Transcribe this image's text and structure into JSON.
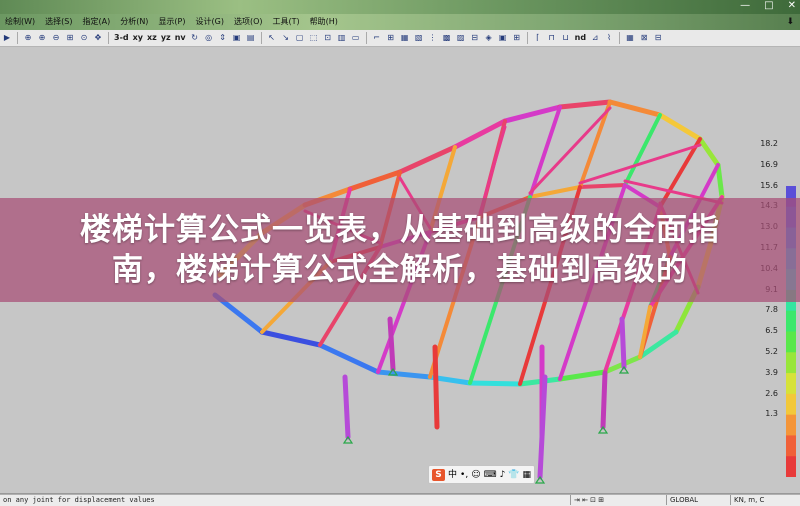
{
  "menu": [
    "绘制(W)",
    "选择(S)",
    "指定(A)",
    "分析(N)",
    "显示(P)",
    "设计(G)",
    "选项(O)",
    "工具(T)",
    "帮助(H)"
  ],
  "menu_extra": "⬇",
  "toolbar": {
    "view_labels": [
      "3-d",
      "xy",
      "xz",
      "yz",
      "nv"
    ],
    "nd_label": "nd"
  },
  "legend": {
    "values": [
      "18.2",
      "16.9",
      "15.6",
      "14.3",
      "13.0",
      "11.7",
      "10.4",
      "9.1",
      "7.8",
      "6.5",
      "5.2",
      "3.9",
      "2.6",
      "1.3"
    ],
    "colors": [
      "#5a4fd8",
      "#4a6ee8",
      "#3b95f0",
      "#37c0ee",
      "#33e0dc",
      "#33e6a0",
      "#3be86c",
      "#59e84a",
      "#98e63a",
      "#d6e23a",
      "#f2c83a",
      "#f49538",
      "#f06038",
      "#e83a3a"
    ]
  },
  "overlay": {
    "line1": "楼梯计算公式一览表，从基础到高级的全面指",
    "line2": "南，楼梯计算公式全解析，基础到高级的"
  },
  "ime_icons": [
    "S",
    "中",
    "•,",
    "☺",
    "⌨",
    "♪",
    "👕",
    "▦"
  ],
  "status": {
    "message": "on any joint for displacement values",
    "cells": [
      "",
      "GLOBAL",
      "KN, m, C"
    ]
  },
  "window_controls": [
    "—",
    "□",
    "✕"
  ]
}
